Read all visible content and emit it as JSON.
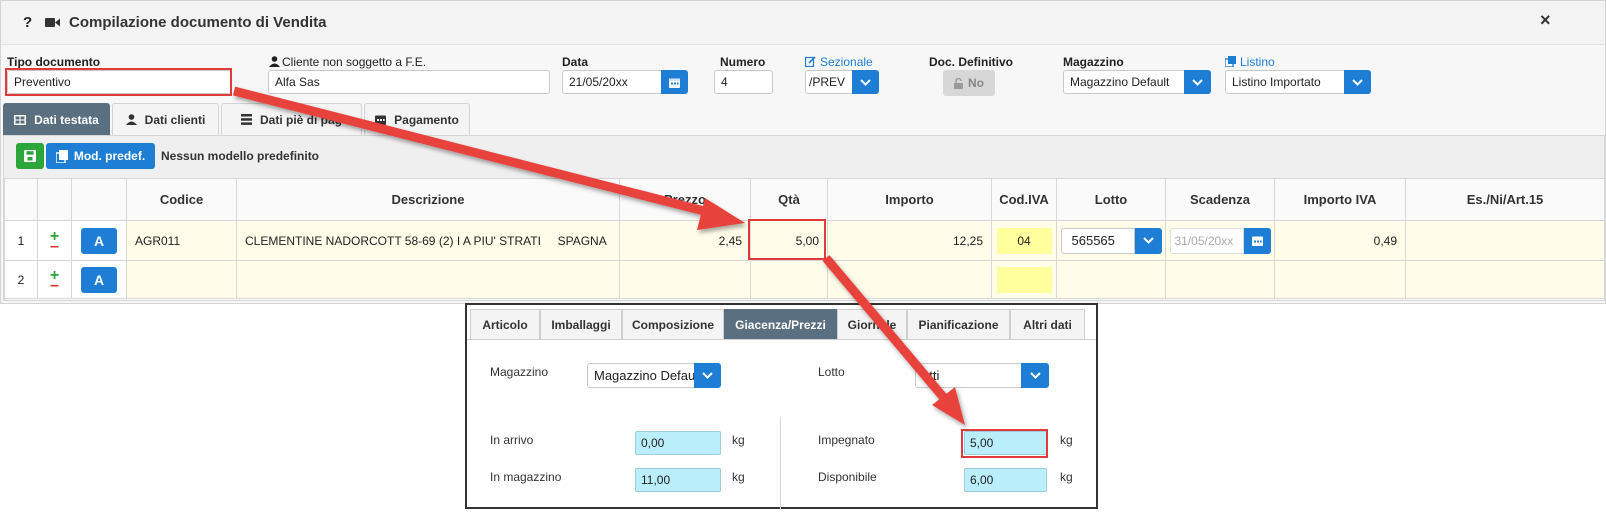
{
  "window": {
    "title": "Compilazione documento di Vendita",
    "help": "?",
    "close": "×"
  },
  "form": {
    "tipo_documento": {
      "label": "Tipo documento",
      "value": "Preventivo"
    },
    "cliente": {
      "label": "Cliente non soggetto a F.E.",
      "value": "Alfa Sas"
    },
    "data": {
      "label": "Data",
      "value": "21/05/20xx"
    },
    "numero": {
      "label": "Numero",
      "value": "4"
    },
    "sezionale": {
      "label": "Sezionale",
      "value": "/PREV"
    },
    "doc_definitivo": {
      "label": "Doc. Definitivo",
      "value": "No"
    },
    "magazzino": {
      "label": "Magazzino",
      "value": "Magazzino Default"
    },
    "listino": {
      "label": "Listino",
      "value": "Listino Importato"
    }
  },
  "tabs": [
    {
      "label": "Dati testata",
      "active": true
    },
    {
      "label": "Dati clienti",
      "active": false
    },
    {
      "label": "Dati piè di pag",
      "active": false
    },
    {
      "label": "Pagamento",
      "active": false
    }
  ],
  "toolbar": {
    "mod_predef": "Mod. predef.",
    "nessun_modello": "Nessun modello predefinito"
  },
  "grid": {
    "columns": [
      "Codice",
      "Descrizione",
      "Prezzo",
      "Qtà",
      "Importo",
      "Cod.IVA",
      "Lotto",
      "Scadenza",
      "Importo IVA",
      "Es./Ni/Art.15"
    ],
    "action_label": "A",
    "rows": [
      {
        "n": "1",
        "codice": "AGR011",
        "descrizione": "CLEMENTINE NADORCOTT 58-69 (2) I A PIU' STRATI     SPAGNA",
        "prezzo": "2,45",
        "qta": "5,00",
        "importo": "12,25",
        "cod_iva": "04",
        "lotto": "565565",
        "scadenza": "31/05/20xx",
        "importo_iva": "0,49",
        "es": ""
      },
      {
        "n": "2",
        "codice": "",
        "descrizione": "",
        "prezzo": "",
        "qta": "",
        "importo": "",
        "cod_iva": "",
        "lotto": "",
        "scadenza": "",
        "importo_iva": "",
        "es": ""
      }
    ]
  },
  "detail": {
    "tabs": [
      {
        "label": "Articolo",
        "active": false
      },
      {
        "label": "Imballaggi",
        "active": false
      },
      {
        "label": "Composizione",
        "active": false
      },
      {
        "label": "Giacenza/Prezzi",
        "active": true
      },
      {
        "label": "Giornale",
        "active": false
      },
      {
        "label": "Pianificazione",
        "active": false
      },
      {
        "label": "Altri dati",
        "active": false
      }
    ],
    "magazzino": {
      "label": "Magazzino",
      "value": "Magazzino Defau"
    },
    "lotto": {
      "label": "Lotto",
      "value": "utti"
    },
    "in_arrivo": {
      "label": "In arrivo",
      "value": "0,00",
      "unit": "kg"
    },
    "in_magazzino": {
      "label": "In magazzino",
      "value": "11,00",
      "unit": "kg"
    },
    "impegnato": {
      "label": "Impegnato",
      "value": "5,00",
      "unit": "kg"
    },
    "disponibile": {
      "label": "Disponibile",
      "value": "6,00",
      "unit": "kg"
    }
  },
  "colors": {
    "accent": "#1e7ed6",
    "active_tab": "#5a6f80",
    "highlight": "#e03b3b",
    "row_bg": "#fffdea",
    "iva_bg": "#ffff9e",
    "cyan_field": "#b9eefa"
  }
}
